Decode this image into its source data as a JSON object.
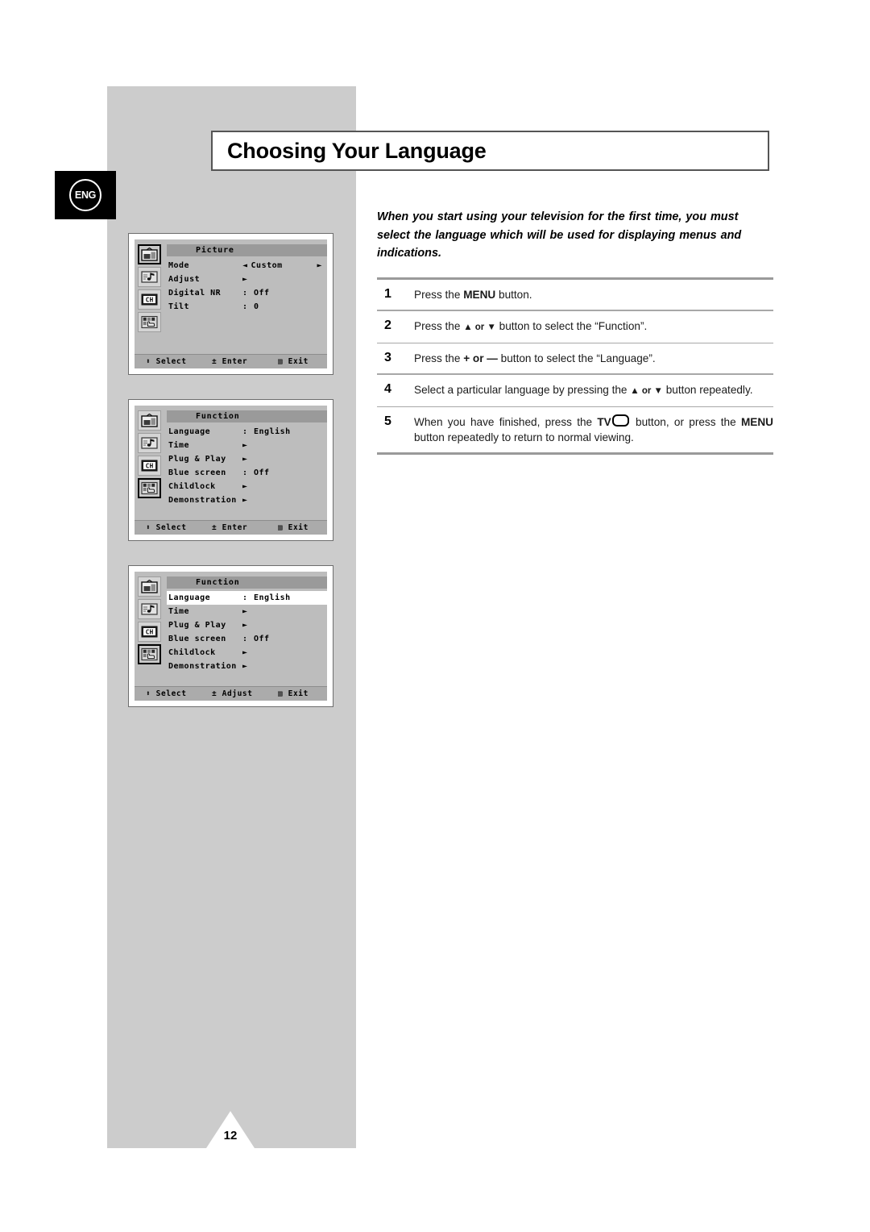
{
  "page": {
    "title": "Choosing Your Language",
    "language_badge": "ENG",
    "page_number": "12"
  },
  "intro": {
    "text": "When you start using your television for the first time, you must select the language which will be used for displaying menus and indications."
  },
  "steps": [
    {
      "number": "1",
      "text_before": "Press the ",
      "bold": "MENU",
      "text_after": " button."
    },
    {
      "number": "2",
      "text_before": "Press the ",
      "bold": "▲ or ▼",
      "text_after": " button to select the “Function”."
    },
    {
      "number": "3",
      "text_before": "Press the ",
      "bold": "+ or —",
      "text_after": " button to select the “Language”."
    },
    {
      "number": "4",
      "text_before": "Select a particular language by pressing the ",
      "bold": "▲ or ▼",
      "text_after": " button repeatedly."
    },
    {
      "number": "5",
      "text_before": "When you have finished, press the ",
      "bold": "TV",
      "text_mid": " button, or press the ",
      "bold2": "MENU",
      "text_after": " button repeatedly to return to normal viewing."
    }
  ],
  "osd_menus": [
    {
      "id": "picture",
      "heading": "Picture",
      "selected_icon": 0,
      "icons": [
        "picture-icon",
        "sound-icon",
        "channel-icon",
        "function-icon"
      ],
      "rows": [
        {
          "label": "Mode",
          "separator": "◄",
          "value": "Custom",
          "right_arrow": "►",
          "highlight": false
        },
        {
          "label": "Adjust",
          "separator": "",
          "value": "",
          "mid_arrow": "►",
          "highlight": false
        },
        {
          "label": "Digital NR",
          "separator": ":",
          "value": "Off",
          "highlight": false
        },
        {
          "label": "Tilt",
          "separator": ":",
          "value": "0",
          "highlight": false
        }
      ],
      "footer": {
        "select": "⬍ Select",
        "middle": "± Enter",
        "exit": "▥ Exit"
      }
    },
    {
      "id": "function",
      "heading": "Function",
      "selected_icon": 3,
      "icons": [
        "picture-icon",
        "sound-icon",
        "channel-icon",
        "function-icon"
      ],
      "rows": [
        {
          "label": "Language",
          "separator": ":",
          "value": "English",
          "highlight": false
        },
        {
          "label": "Time",
          "separator": "",
          "value": "",
          "mid_arrow": "►",
          "highlight": false
        },
        {
          "label": "Plug & Play",
          "separator": "",
          "value": "",
          "mid_arrow": "►",
          "highlight": false
        },
        {
          "label": "Blue screen",
          "separator": ":",
          "value": "Off",
          "highlight": false
        },
        {
          "label": "Childlock",
          "separator": "",
          "value": "",
          "mid_arrow": "►",
          "highlight": false
        },
        {
          "label": "Demonstration",
          "separator": "",
          "value": "",
          "mid_arrow": "►",
          "highlight": false
        }
      ],
      "footer": {
        "select": "⬍ Select",
        "middle": "± Enter",
        "exit": "▥ Exit"
      }
    },
    {
      "id": "language",
      "heading": "Function",
      "selected_icon": 3,
      "icons": [
        "picture-icon",
        "sound-icon",
        "channel-icon",
        "function-icon"
      ],
      "rows": [
        {
          "label": "Language",
          "separator": ":",
          "value": "English",
          "highlight": true
        },
        {
          "label": "Time",
          "separator": "",
          "value": "",
          "mid_arrow": "►",
          "highlight": false
        },
        {
          "label": "Plug & Play",
          "separator": "",
          "value": "",
          "mid_arrow": "►",
          "highlight": false
        },
        {
          "label": "Blue screen",
          "separator": ":",
          "value": "Off",
          "highlight": false
        },
        {
          "label": "Childlock",
          "separator": "",
          "value": "",
          "mid_arrow": "►",
          "highlight": false
        },
        {
          "label": "Demonstration",
          "separator": "",
          "value": "",
          "mid_arrow": "►",
          "highlight": false
        }
      ],
      "footer": {
        "select": "⬍ Select",
        "middle": "± Adjust",
        "exit": "▥ Exit"
      }
    }
  ],
  "colors": {
    "band_gray": "#cccccc",
    "osd_body": "#bdbdbd",
    "osd_heading": "#9a9a9a",
    "osd_footer": "#ababab",
    "rule": "#9a9a9a"
  }
}
